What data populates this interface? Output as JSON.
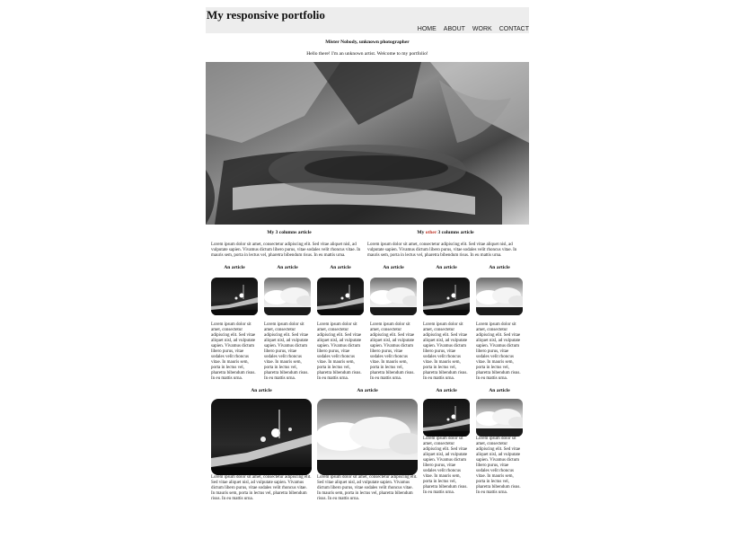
{
  "site": {
    "title": "My responsive portfolio",
    "nav": [
      "HOME",
      "ABOUT",
      "WORK",
      "CONTACT"
    ],
    "subtitle": "Mister Nobody, unknown photographer",
    "welcome": "Hello there! I'm an unknown artist. Welcome to my portfolio!"
  },
  "columns": {
    "left_title": "My 3 columns article",
    "right_title_pre": "My ",
    "right_title_accent": "other",
    "right_title_post": " 3 columns article",
    "left_text": "Lorem ipsum dolor sit amet, consectetur adipiscing elit. Sed vitae aliquet nisl, ad vulputate sapien. Vivamus dictum libero purus, vitae sodales velit rhoncus vitae. In mauris sem, porta in lectus vel, pharetra bibendum risus. In eu mattis urna.",
    "right_text": "Lorem ipsum dolor sit amet, consectetur adipiscing elit. Sed vitae aliquet nisl, ad vulputate sapien. Vivamus dictum libero purus, vitae sodales velit rhoncus vitae. In mauris sem, porta in lectus vel, pharetra bibendum risus. In eu mattis urna."
  },
  "articles": {
    "title": "An article",
    "text": "Lorem ipsum dolor sit amet, consectetur adipiscing elit. Sed vitae aliquet nisl, ad vulputate sapien. Vivamus dictum libero purus, vitae sodales velit rhoncus vitae. In mauris sem, porta in lectus vel, pharetra bibendum risus. In eu mattis urna.",
    "wide_text": "Lorem ipsum dolor sit amet, consectetur adipiscing elit. Sed vitae aliquet nisl, ad vulputate sapien. Vivamus dictum libero purus, vitae sodales velit rhoncus vitae. In mauris sem, porta in lectus vel, pharetra bibendum risus. In eu mattis urna."
  },
  "colors": {
    "header_bg": "#ededed",
    "accent": "#c0392b"
  }
}
